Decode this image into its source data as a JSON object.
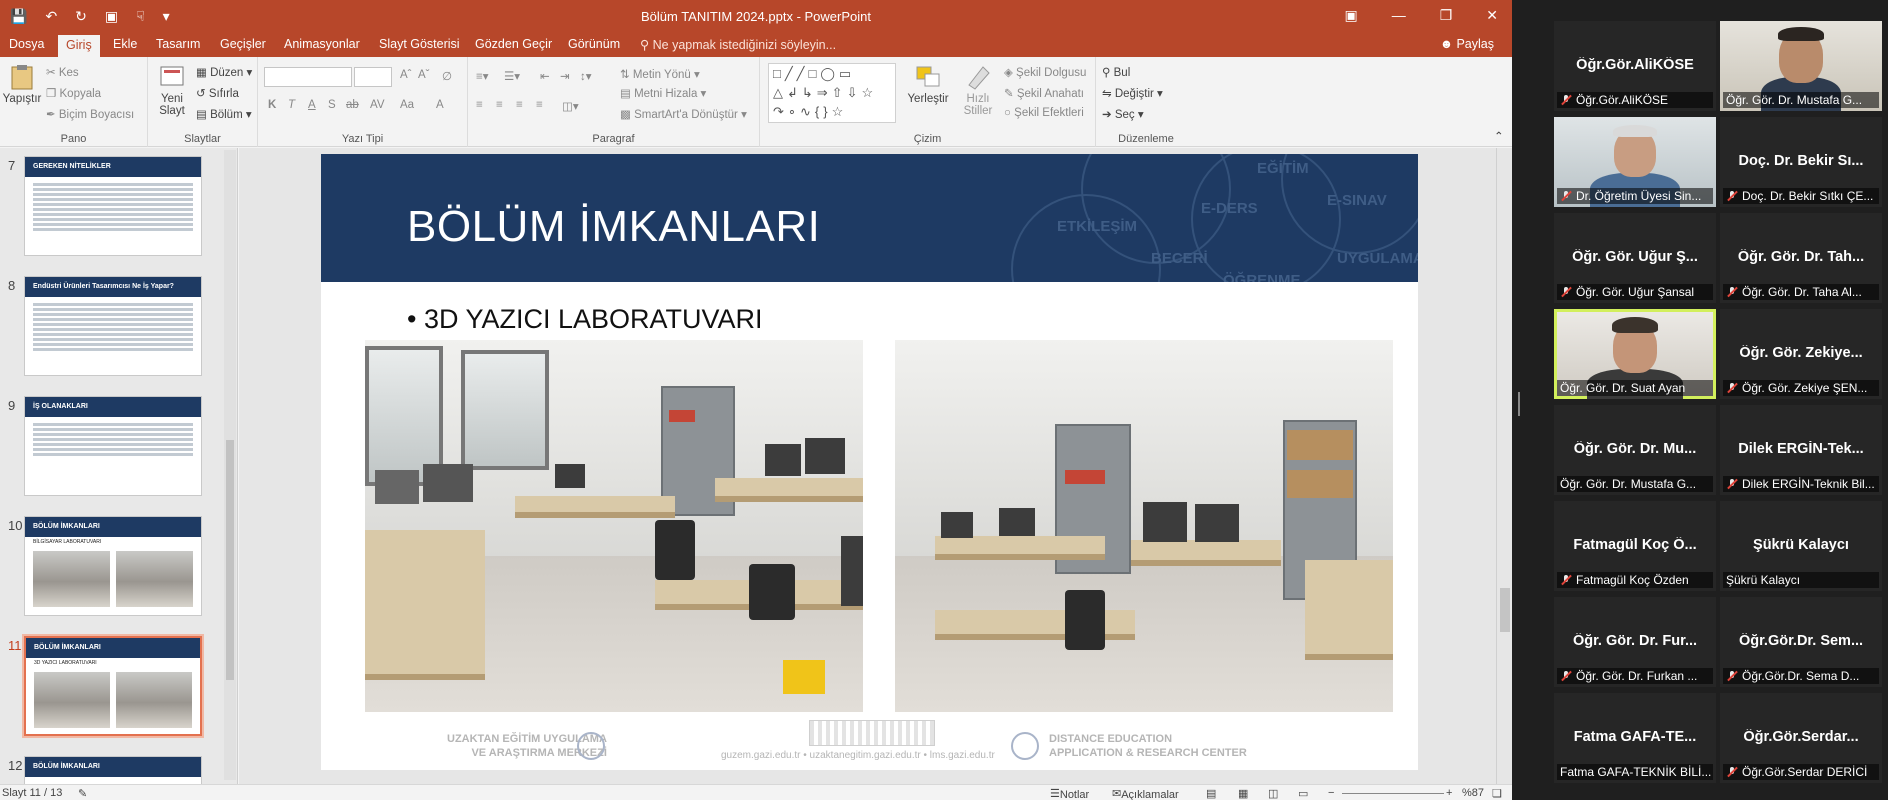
{
  "window": {
    "title": "Bölüm TANITIM 2024.pptx - PowerPoint"
  },
  "tabs": [
    "Dosya",
    "Giriş",
    "Ekle",
    "Tasarım",
    "Geçişler",
    "Animasyonlar",
    "Slayt Gösterisi",
    "Gözden Geçir",
    "Görünüm"
  ],
  "active_tab": "Giriş",
  "tell_me": "Ne yapmak istediğinizi söyleyin...",
  "share": "Paylaş",
  "ribbon": {
    "pano": {
      "label": "Pano",
      "paste": "Yapıştır",
      "cut": "Kes",
      "copy": "Kopyala",
      "format_painter": "Biçim Boyacısı"
    },
    "slaytlar": {
      "label": "Slaytlar",
      "new_slide_1": "Yeni",
      "new_slide_2": "Slayt",
      "layout": "Düzen",
      "reset": "Sıfırla",
      "section": "Bölüm"
    },
    "yazi_tipi": {
      "label": "Yazı Tipi",
      "bold": "K",
      "italic": "T",
      "underline": "A",
      "strike": "S",
      "shadow": "ab",
      "av": "AV",
      "aa": "Aa",
      "color": "A"
    },
    "paragraf": {
      "label": "Paragraf",
      "text_direction": "Metin Yönü",
      "align_text": "Metni Hizala",
      "smartart": "SmartArt'a Dönüştür"
    },
    "cizim": {
      "label": "Çizim",
      "arrange_1": "Yerleştir",
      "quick_1": "Hızlı",
      "quick_2": "Stiller",
      "fill": "Şekil Dolgusu",
      "outline": "Şekil Anahatı",
      "effects": "Şekil Efektleri"
    },
    "duzenleme": {
      "label": "Düzenleme",
      "find": "Bul",
      "replace": "Değiştir",
      "select": "Seç"
    }
  },
  "thumbnails": [
    {
      "num": "7",
      "title": "GEREKEN NİTELİKLER",
      "selected": false
    },
    {
      "num": "8",
      "title": "Endüstri Ürünleri Tasarımcısı Ne İş Yapar?",
      "selected": false
    },
    {
      "num": "9",
      "title": "İŞ OLANAKLARI",
      "selected": false
    },
    {
      "num": "10",
      "title": "BÖLÜM İMKANLARI",
      "subtitle": "BİLGİSAYAR LABORATUVARI",
      "selected": false
    },
    {
      "num": "11",
      "title": "BÖLÜM İMKANLARI",
      "subtitle": "3D YAZICI LABORATUVARI",
      "selected": true
    },
    {
      "num": "12",
      "title": "BÖLÜM İMKANLARI",
      "selected": false
    }
  ],
  "slide": {
    "title": "BÖLÜM İMKANLARI",
    "bullet": "3D YAZICI LABORATUVARI",
    "banner_words": [
      "EĞİTİM",
      "E-SINAV",
      "ETKİLEŞİM",
      "E-DERS",
      "BECERİ",
      "UYGULAMA",
      "ÖĞRENME"
    ],
    "footer_left_1": "UZAKTAN EĞİTİM UYGULAMA",
    "footer_left_2": "VE ARAŞTIRMA MERKEZİ",
    "footer_right_1": "DISTANCE EDUCATION",
    "footer_right_2": "APPLICATION & RESEARCH CENTER",
    "footer_mid": "guzem.gazi.edu.tr  •  uzaktanegitim.gazi.edu.tr  •  lms.gazi.edu.tr"
  },
  "statusbar": {
    "slide_info": "Slayt 11 / 13",
    "notes": "Notlar",
    "comments": "Açıklamalar",
    "zoom": "%87"
  },
  "participants": [
    {
      "big": "Öğr.Gör.AliKÖSE",
      "label": "Öğr.Gör.AliKÖSE",
      "muted": true,
      "video": false
    },
    {
      "big": "",
      "label": "Öğr. Gör. Dr. Mustafa G...",
      "muted": false,
      "video": true
    },
    {
      "big": "",
      "label": "Dr. Öğretim Üyesi Sin...",
      "muted": true,
      "video": true
    },
    {
      "big": "Doç. Dr. Bekir Sı...",
      "label": "Doç. Dr. Bekir Sıtkı ÇE...",
      "muted": true,
      "video": false
    },
    {
      "big": "Öğr. Gör. Uğur Ş...",
      "label": "Öğr. Gör. Uğur Şansal",
      "muted": true,
      "video": false
    },
    {
      "big": "Öğr. Gör. Dr. Tah...",
      "label": "Öğr. Gör. Dr. Taha Al...",
      "muted": true,
      "video": false
    },
    {
      "big": "",
      "label": "Öğr. Gör. Dr. Suat Ayan",
      "muted": false,
      "video": true,
      "active": true
    },
    {
      "big": "Öğr. Gör. Zekiye...",
      "label": "Öğr. Gör. Zekiye ŞEN...",
      "muted": true,
      "video": false
    },
    {
      "big": "Öğr. Gör. Dr. Mu...",
      "label": "Öğr. Gör. Dr. Mustafa G...",
      "muted": false,
      "video": false
    },
    {
      "big": "Dilek ERGİN-Tek...",
      "label": "Dilek ERGİN-Teknik Bil...",
      "muted": true,
      "video": false
    },
    {
      "big": "Fatmagül Koç Ö...",
      "label": "Fatmagül Koç Özden",
      "muted": true,
      "video": false
    },
    {
      "big": "Şükrü Kalaycı",
      "label": "Şükrü Kalaycı",
      "muted": false,
      "video": false
    },
    {
      "big": "Öğr. Gör. Dr. Fur...",
      "label": "Öğr. Gör. Dr. Furkan ...",
      "muted": true,
      "video": false
    },
    {
      "big": "Öğr.Gör.Dr. Sem...",
      "label": "Öğr.Gör.Dr. Sema D...",
      "muted": true,
      "video": false
    },
    {
      "big": "Fatma GAFA-TE...",
      "label": "Fatma GAFA-TEKNİK BİLİ...",
      "muted": false,
      "video": false
    },
    {
      "big": "Öğr.Gör.Serdar...",
      "label": "Öğr.Gör.Serdar DERİCİ",
      "muted": true,
      "video": false
    }
  ],
  "colors": {
    "accent": "#b7472a",
    "slide_band": "#1e3a63",
    "active_speaker": "#d2ef5c"
  }
}
